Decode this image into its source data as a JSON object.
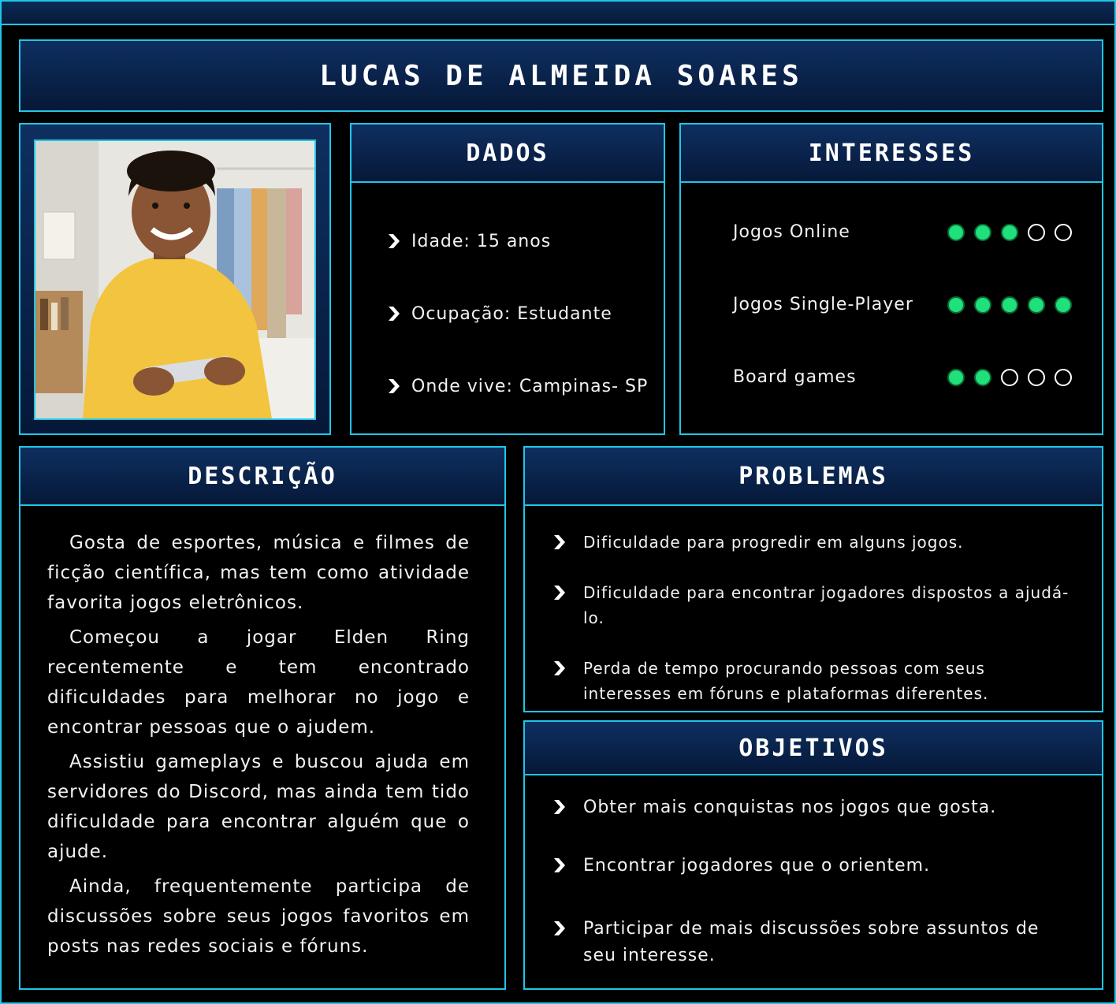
{
  "persona": {
    "name": "Lucas de Almeida Soares"
  },
  "dados": {
    "title": "Dados",
    "items": [
      "Idade: 15 anos",
      "Ocupação: Estudante",
      "Onde vive: Campinas- SP"
    ]
  },
  "interesses": {
    "title": "Interesses",
    "items": [
      {
        "label": "Jogos Online",
        "rating": 3,
        "max": 5
      },
      {
        "label": "Jogos Single-Player",
        "rating": 5,
        "max": 5
      },
      {
        "label": "Board games",
        "rating": 2,
        "max": 5
      }
    ]
  },
  "descricao": {
    "title": "Descrição",
    "paragraphs": [
      "Gosta de esportes, música e filmes de ficção científica, mas tem como atividade favorita jogos eletrônicos.",
      "Começou a jogar Elden Ring recentemente e tem encontrado dificuldades para melhorar no jogo e encontrar pessoas que o ajudem.",
      "Assistiu gameplays e buscou ajuda em servidores do Discord, mas ainda tem tido dificuldade para encontrar alguém que o ajude.",
      "Ainda, frequentemente participa de discussões sobre seus jogos favoritos em posts nas redes sociais e fóruns."
    ]
  },
  "problemas": {
    "title": "Problemas",
    "items": [
      "Dificuldade para progredir em alguns jogos.",
      "Dificuldade para encontrar jogadores dispostos a ajudá-lo.",
      "Perda de tempo procurando pessoas com seus interesses em fóruns e plataformas diferentes."
    ]
  },
  "objetivos": {
    "title": "Objetivos",
    "items": [
      "Obter mais conquistas nos jogos que gosta.",
      "Encontrar jogadores que o orientem.",
      "Participar de mais discussões sobre assuntos de seu interesse."
    ]
  },
  "colors": {
    "accent": "#1fc6e6",
    "header_bg": "#0e2f60",
    "dot_on": "#1fe07a"
  }
}
